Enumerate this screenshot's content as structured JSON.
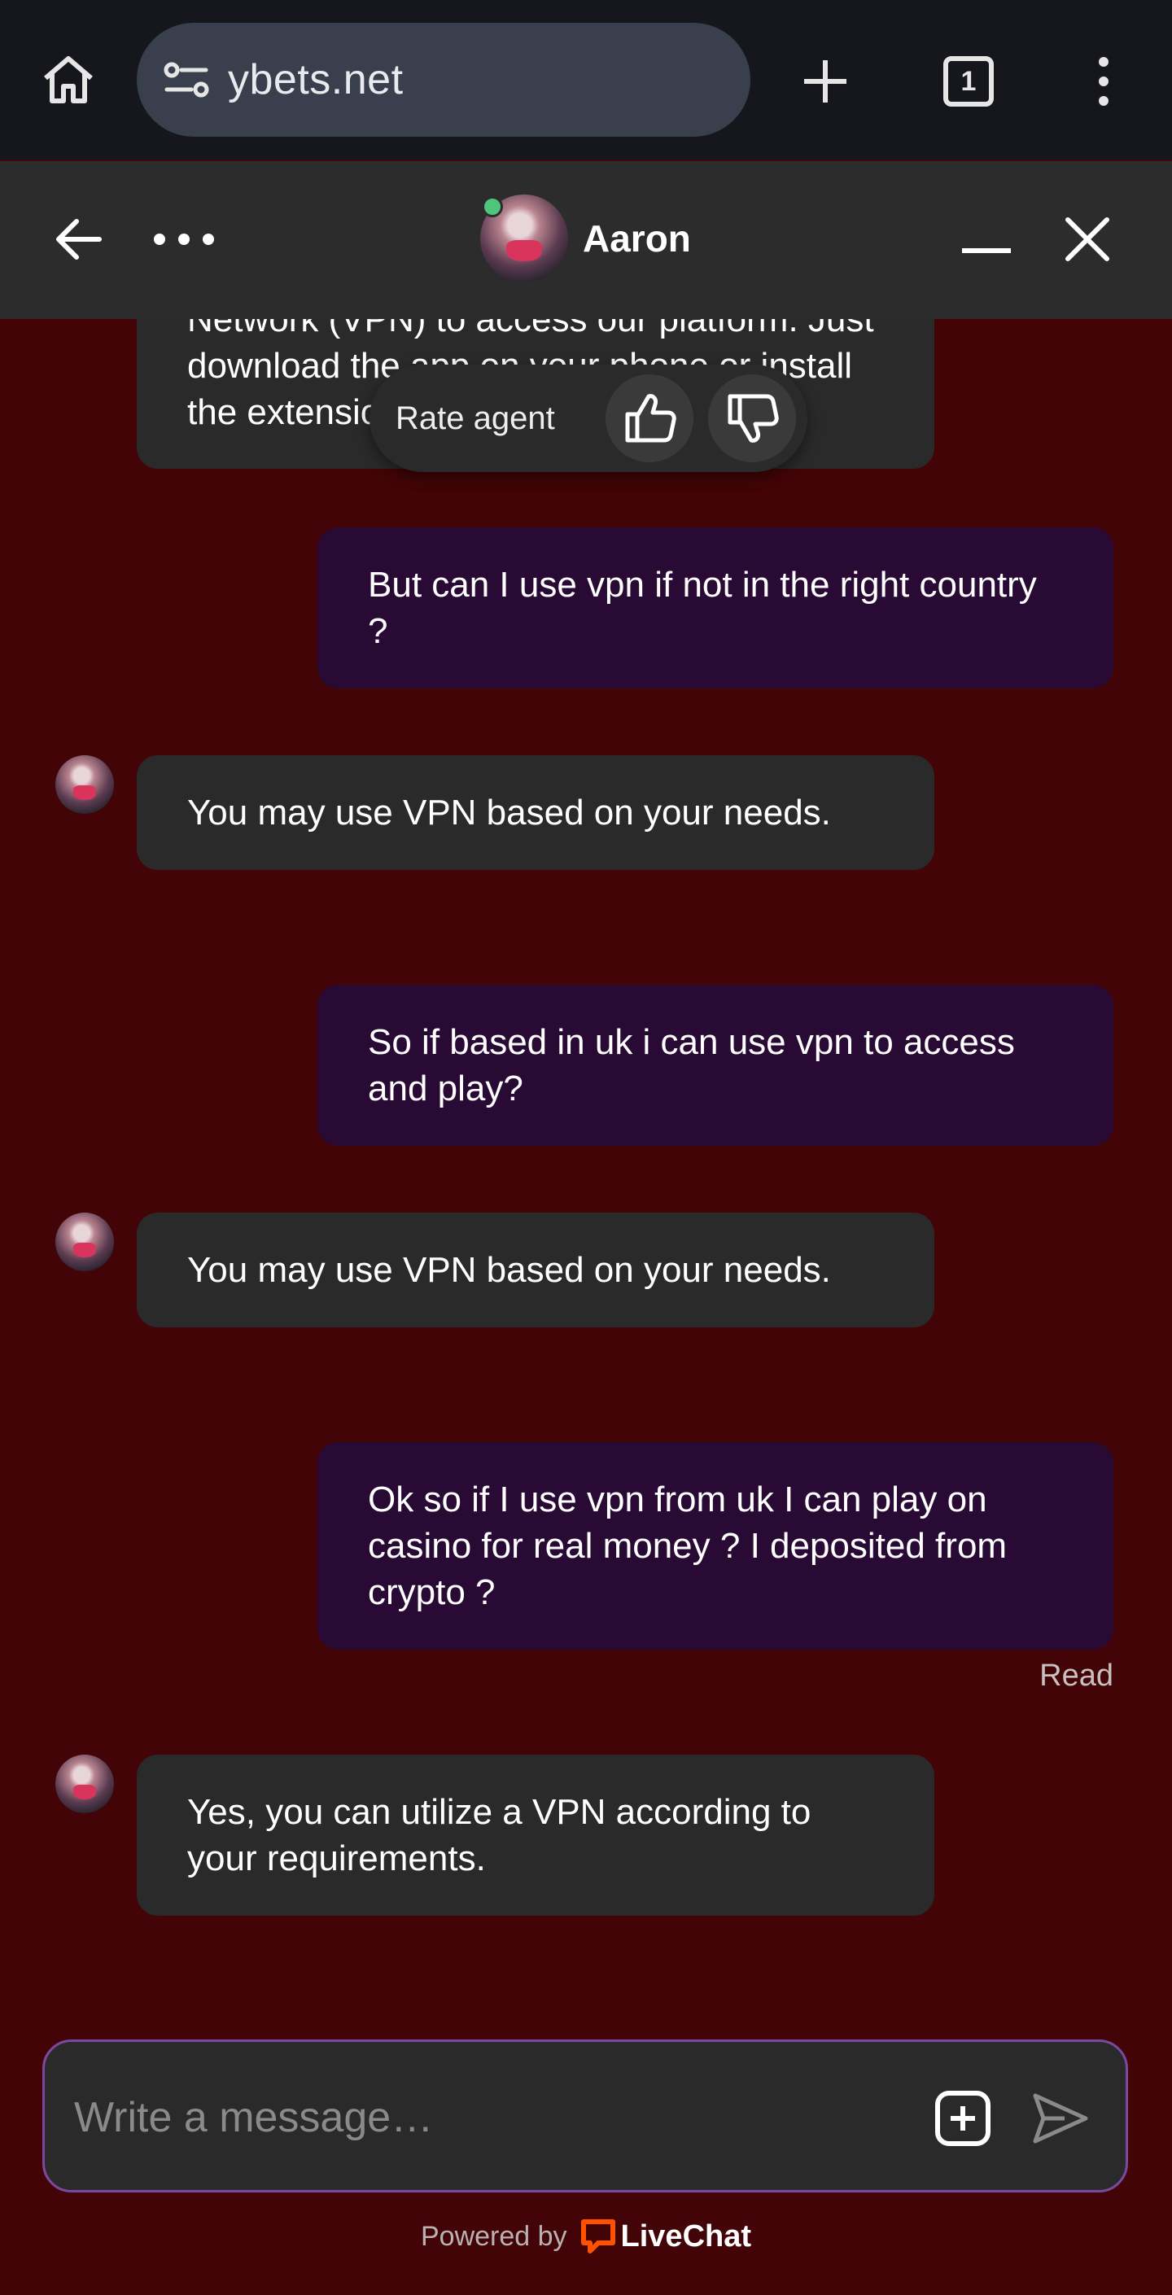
{
  "browser": {
    "url": "ybets.net",
    "tab_count": "1"
  },
  "header": {
    "agent_name": "Aaron",
    "agent_status": "online"
  },
  "rate": {
    "label": "Rate agent"
  },
  "messages": [
    {
      "from": "agent",
      "text": "Network (VPN) to access our platform. Just download the app on your phone or install the extension on your browser.",
      "partial": true
    },
    {
      "from": "user",
      "text": "But can I use vpn if not in the right country ?"
    },
    {
      "from": "agent",
      "text": "You may use VPN based on your needs."
    },
    {
      "from": "user",
      "text": "So if based in uk i can use vpn to access and play?"
    },
    {
      "from": "agent",
      "text": "You may use VPN based on your needs."
    },
    {
      "from": "user",
      "text": "Ok so if I use vpn from uk I can play on casino for real money ? I deposited from crypto ?"
    },
    {
      "from": "agent",
      "text": "Yes, you can utilize a VPN according to your requirements."
    }
  ],
  "read_receipt": "Read",
  "composer": {
    "placeholder": "Write a message…"
  },
  "footer": {
    "powered_by": "Powered by",
    "brand": "LiveChat"
  },
  "colors": {
    "background": "#420406",
    "agent_bubble": "#2a2a2a",
    "user_bubble": "#280a34",
    "composer_border": "#7a4aa0",
    "brand_orange": "#ff5100",
    "online": "#4fc47b"
  }
}
